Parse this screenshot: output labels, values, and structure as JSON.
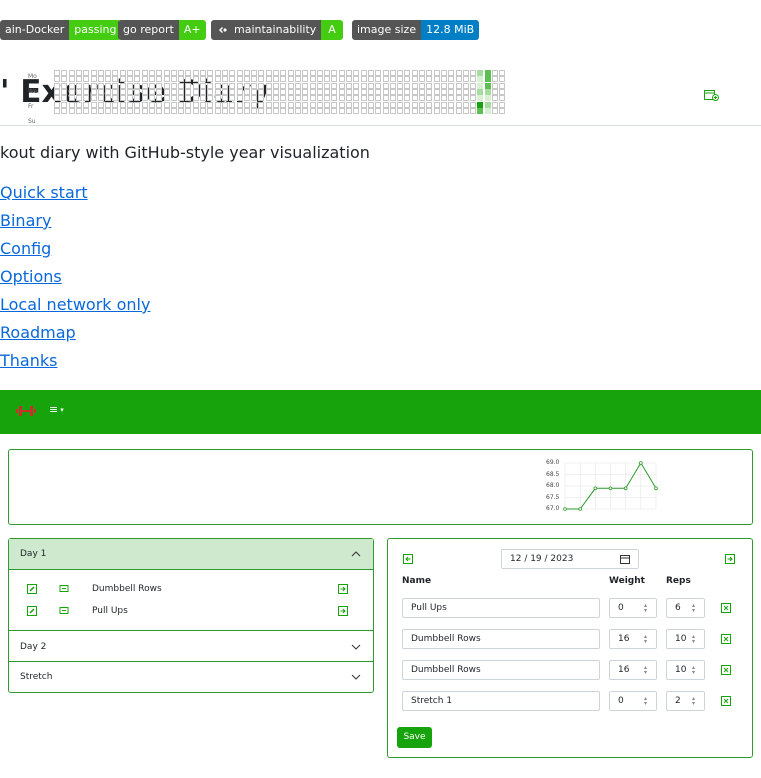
{
  "badges": [
    {
      "label": "ain-Docker",
      "value": "passing",
      "color": "#4c1"
    },
    {
      "label": "go report",
      "value": "A+",
      "color": "#4c1"
    },
    {
      "label": "maintainability",
      "value": "A",
      "color": "#4c1"
    },
    {
      "label": "image size",
      "value": "12.8 MiB",
      "color": "#007ec6"
    }
  ],
  "readme": {
    "title": "' Exercise Diary",
    "description": "kout diary with GitHub-style year visualization",
    "toc": [
      "Quick start",
      "Binary",
      "Config",
      "Options",
      "Local network only",
      "Roadmap",
      "Thanks"
    ]
  },
  "app": {
    "colors": {
      "primary": "#16a30c",
      "border": "#2e9a2a",
      "active_bg": "#cfe9cf"
    },
    "navbar": {
      "brand_icon": "dumbbell-icon",
      "menu_icon": "hamburger-icon"
    },
    "heatmap": {
      "day_labels": [
        "Mo",
        "We",
        "Fr",
        "Su"
      ],
      "weeks": 53,
      "activity": [
        {
          "week": 50,
          "day": 0,
          "level": 2
        },
        {
          "week": 50,
          "day": 1,
          "level": 1
        },
        {
          "week": 50,
          "day": 2,
          "level": 1
        },
        {
          "week": 50,
          "day": 3,
          "level": 2
        },
        {
          "week": 50,
          "day": 4,
          "level": 1
        },
        {
          "week": 50,
          "day": 5,
          "level": 4
        },
        {
          "week": 50,
          "day": 6,
          "level": 3
        },
        {
          "week": 51,
          "day": 0,
          "level": 3
        },
        {
          "week": 51,
          "day": 1,
          "level": 3
        },
        {
          "week": 51,
          "day": 2,
          "level": 3
        },
        {
          "week": 51,
          "day": 3,
          "level": 2
        },
        {
          "week": 51,
          "day": 4,
          "level": 1
        },
        {
          "week": 51,
          "day": 5,
          "level": 2
        },
        {
          "week": 51,
          "day": 6,
          "level": 1
        }
      ]
    },
    "weight_chart": {
      "type": "line",
      "y_ticks": [
        "69.0",
        "68.5",
        "68.0",
        "67.5",
        "67.0"
      ],
      "ylim": [
        67.0,
        69.0
      ],
      "values": [
        67.0,
        67.0,
        67.9,
        67.9,
        67.9,
        69.0,
        67.9
      ],
      "grid": true
    },
    "workouts": [
      {
        "name": "Day 1",
        "expanded": true,
        "exercises": [
          "Dumbbell Rows",
          "Pull Ups"
        ]
      },
      {
        "name": "Day 2",
        "expanded": false,
        "exercises": []
      },
      {
        "name": "Stretch",
        "expanded": false,
        "exercises": []
      }
    ],
    "entry": {
      "date": "12 / 19 / 2023",
      "columns": {
        "name": "Name",
        "weight": "Weight",
        "reps": "Reps"
      },
      "rows": [
        {
          "name": "Pull Ups",
          "weight": "0",
          "reps": "6"
        },
        {
          "name": "Dumbbell Rows",
          "weight": "16",
          "reps": "10"
        },
        {
          "name": "Dumbbell Rows",
          "weight": "16",
          "reps": "10"
        },
        {
          "name": "Stretch 1",
          "weight": "0",
          "reps": "2"
        }
      ],
      "save_label": "Save"
    }
  }
}
